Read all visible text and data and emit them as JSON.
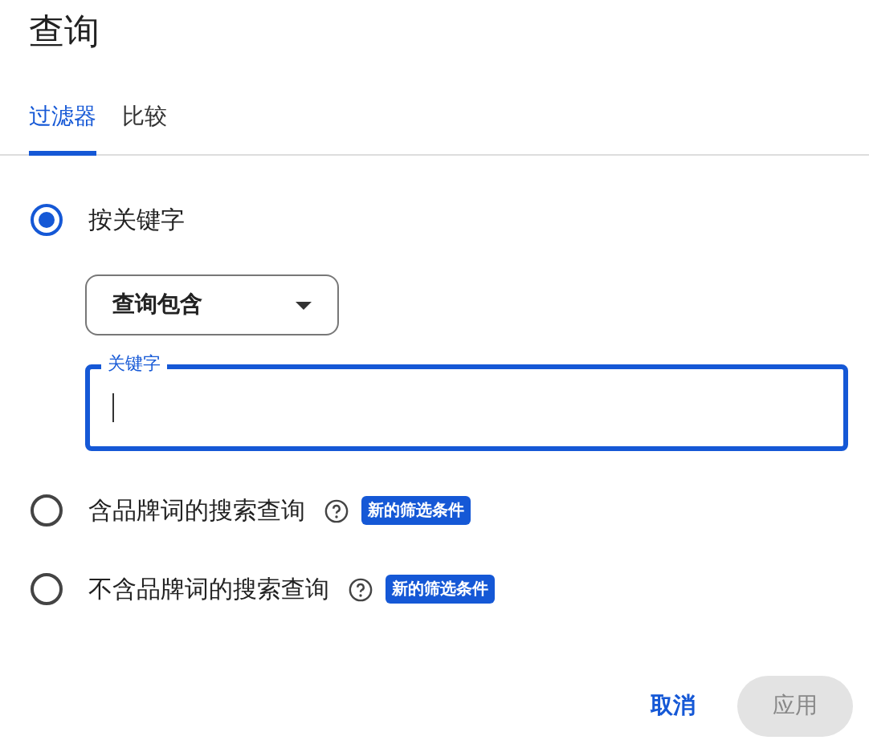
{
  "title": "查询",
  "tabs": [
    {
      "label": "过滤器",
      "selected": true
    },
    {
      "label": "比较",
      "selected": false
    }
  ],
  "options": [
    {
      "label": "按关键字",
      "selected": true,
      "dropdown": {
        "value": "查询包含"
      },
      "field": {
        "label": "关键字",
        "focused": true
      }
    },
    {
      "label": "含品牌词的搜索查询",
      "selected": false,
      "help": true,
      "badge": "新的筛选条件"
    },
    {
      "label": "不含品牌词的搜索查询",
      "selected": false,
      "help": true,
      "badge": "新的筛选条件"
    }
  ],
  "buttons": [
    {
      "label": "取消",
      "disabled": false
    },
    {
      "label": "应用",
      "disabled": true
    }
  ]
}
